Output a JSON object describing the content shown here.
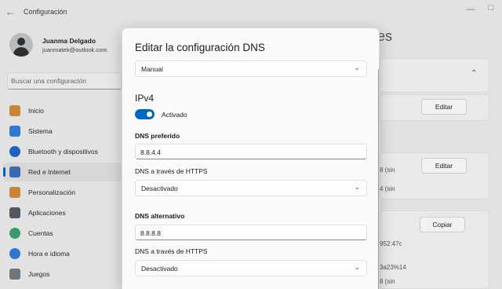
{
  "app": {
    "title": "Configuración",
    "back_icon": "back-arrow-icon"
  },
  "user": {
    "name": "Juanma Delgado",
    "email": "juanmatek@outlook.com"
  },
  "search": {
    "placeholder": "Buscar una configuración"
  },
  "sidebar": {
    "items": [
      {
        "label": "Inicio",
        "icon": "home-icon",
        "color": "#d08b39"
      },
      {
        "label": "Sistema",
        "icon": "system-icon",
        "color": "#2f7fd8"
      },
      {
        "label": "Bluetooth y dispositivos",
        "icon": "bluetooth-icon",
        "color": "#2466c7"
      },
      {
        "label": "Red e Internet",
        "icon": "network-icon",
        "color": "#3c6fb8",
        "active": true
      },
      {
        "label": "Personalización",
        "icon": "brush-icon",
        "color": "#d18a3a"
      },
      {
        "label": "Aplicaciones",
        "icon": "apps-icon",
        "color": "#555c66"
      },
      {
        "label": "Cuentas",
        "icon": "accounts-icon",
        "color": "#3aa370"
      },
      {
        "label": "Hora e idioma",
        "icon": "time-language-icon",
        "color": "#2f7fd8"
      },
      {
        "label": "Juegos",
        "icon": "games-icon",
        "color": "#737b84"
      }
    ]
  },
  "right": {
    "heading": "es",
    "buttons": {
      "edit1": "Editar",
      "edit2": "Editar",
      "copy": "Copiar"
    },
    "snippets": {
      "s1": "8 (sin",
      "s2": "4 (sin",
      "s3": "952:47c",
      "s4": "3a23%14",
      "s5": "8 (sin"
    }
  },
  "dialog": {
    "title": "Editar la configuración DNS",
    "mode": "Manual",
    "section": "IPv4",
    "toggle_state": "Activado",
    "preferred": {
      "label": "DNS preferido",
      "value": "8.8.4.4",
      "https_label": "DNS a través de HTTPS",
      "https_value": "Desactivado"
    },
    "alternate": {
      "label": "DNS alternativo",
      "value": "8.8.8.8",
      "https_label": "DNS a través de HTTPS",
      "https_value": "Desactivado"
    }
  },
  "colors": {
    "accent": "#0067c0",
    "dialog_bg": "#fafafa"
  }
}
